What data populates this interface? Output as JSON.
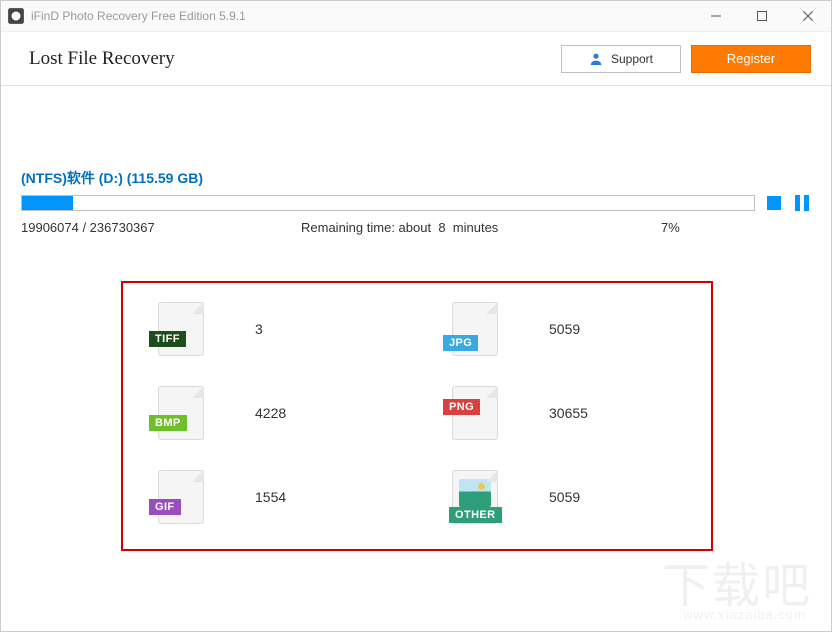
{
  "window": {
    "title": "iFinD Photo Recovery Free Edition 5.9.1"
  },
  "toolbar": {
    "page_title": "Lost File Recovery",
    "support_label": "Support",
    "register_label": "Register"
  },
  "scan": {
    "drive_label": "(NTFS)软件 (D:) (115.59 GB)",
    "progress_percent_value": 7,
    "sectors": "19906074 / 236730367",
    "remaining_prefix": "Remaining time: about",
    "remaining_value": "8",
    "remaining_unit": "minutes",
    "percent_text": "7%"
  },
  "results": [
    {
      "type": "TIFF",
      "badge_class": "tiff",
      "count": "3"
    },
    {
      "type": "JPG",
      "badge_class": "jpg",
      "count": "5059"
    },
    {
      "type": "BMP",
      "badge_class": "bmp",
      "count": "4228"
    },
    {
      "type": "PNG",
      "badge_class": "png",
      "count": "30655"
    },
    {
      "type": "GIF",
      "badge_class": "gif",
      "count": "1554"
    },
    {
      "type": "OTHER",
      "badge_class": "other",
      "count": "5059"
    }
  ],
  "watermark": {
    "main": "下载吧",
    "sub": "www.xiazaiba.com"
  }
}
